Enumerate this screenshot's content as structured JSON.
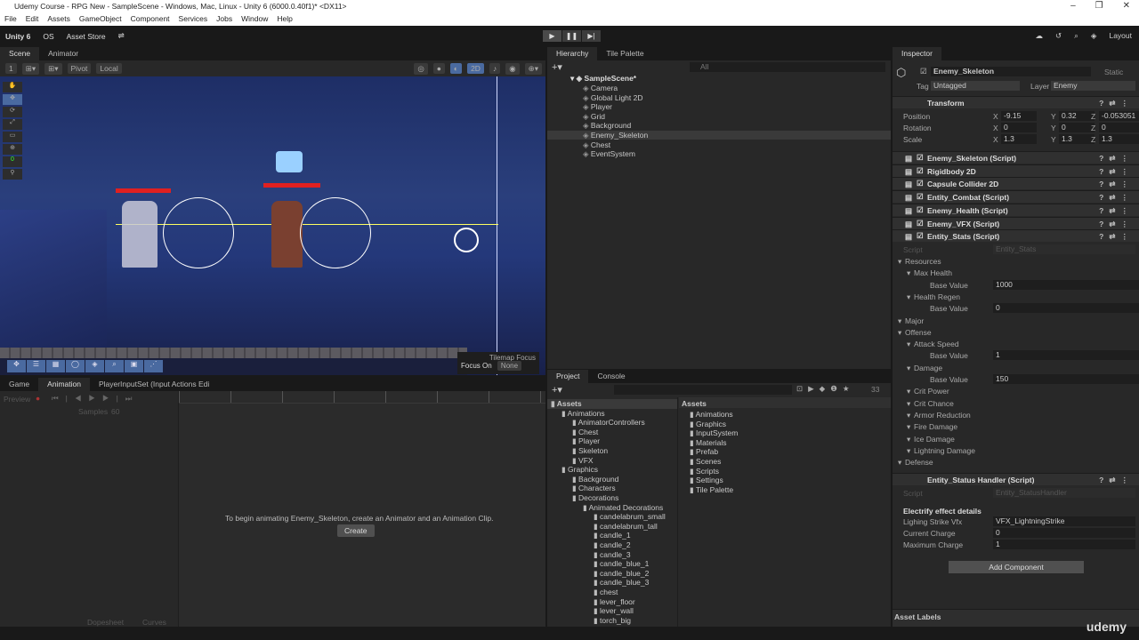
{
  "window": {
    "title": "Udemy Course - RPG New - SampleScene - Windows, Mac, Linux - Unity 6 (6000.0.40f1)* <DX11>"
  },
  "menu": [
    "File",
    "Edit",
    "Assets",
    "GameObject",
    "Component",
    "Services",
    "Jobs",
    "Window",
    "Help"
  ],
  "toolbar": {
    "account": "Unity 6",
    "os": "OS",
    "asset_store": "Asset Store",
    "layout": "Layout"
  },
  "scene_tabs": [
    "Scene",
    "Animator"
  ],
  "scene_toolbar": {
    "layer": "1",
    "pivot": "Pivot",
    "local": "Local",
    "mode_2d": "2D"
  },
  "scene": {
    "tilemap_focus": "Tilemap Focus",
    "focus_on": "Focus On",
    "focus_value": "None"
  },
  "bottom_tabs": [
    "Game",
    "Animation",
    "PlayerInputSet (Input Actions Edi"
  ],
  "animation": {
    "preview": "Preview",
    "samples_label": "Samples",
    "samples": "60",
    "message": "To begin animating Enemy_Skeleton, create an Animator and an Animation Clip.",
    "create": "Create",
    "dopesheet": "Dopesheet",
    "curves": "Curves"
  },
  "hierarchy": {
    "title": "Hierarchy",
    "tab2": "Tile Palette",
    "search_placeholder": "All",
    "scene": "SampleScene*",
    "items": [
      "Camera",
      "Global Light 2D",
      "Player",
      "Grid",
      "Background",
      "Enemy_Skeleton",
      "Chest",
      "EventSystem"
    ],
    "selected": "Enemy_Skeleton"
  },
  "project": {
    "tabs": [
      "Project",
      "Console"
    ],
    "count": "33",
    "tree": [
      {
        "label": "Assets",
        "depth": 0
      },
      {
        "label": "Animations",
        "depth": 1
      },
      {
        "label": "AnimatorControllers",
        "depth": 2
      },
      {
        "label": "Chest",
        "depth": 2
      },
      {
        "label": "Player",
        "depth": 2
      },
      {
        "label": "Skeleton",
        "depth": 2
      },
      {
        "label": "VFX",
        "depth": 2
      },
      {
        "label": "Graphics",
        "depth": 1
      },
      {
        "label": "Background",
        "depth": 2
      },
      {
        "label": "Characters",
        "depth": 2
      },
      {
        "label": "Decorations",
        "depth": 2
      },
      {
        "label": "Animated Decorations",
        "depth": 3
      },
      {
        "label": "candelabrum_small",
        "depth": 4
      },
      {
        "label": "candelabrum_tall",
        "depth": 4
      },
      {
        "label": "candle_1",
        "depth": 4
      },
      {
        "label": "candle_2",
        "depth": 4
      },
      {
        "label": "candle_3",
        "depth": 4
      },
      {
        "label": "candle_blue_1",
        "depth": 4
      },
      {
        "label": "candle_blue_2",
        "depth": 4
      },
      {
        "label": "candle_blue_3",
        "depth": 4
      },
      {
        "label": "chest",
        "depth": 4
      },
      {
        "label": "lever_floor",
        "depth": 4
      },
      {
        "label": "lever_wall",
        "depth": 4
      },
      {
        "label": "torch_big",
        "depth": 4
      }
    ],
    "breadcrumb": "Assets",
    "folders": [
      "Animations",
      "Graphics",
      "InputSystem",
      "Materials",
      "Prefab",
      "Scenes",
      "Scripts",
      "Settings",
      "Tile Palette"
    ]
  },
  "inspector": {
    "title": "Inspector",
    "object": "Enemy_Skeleton",
    "static": "Static",
    "tag_label": "Tag",
    "tag": "Untagged",
    "layer_label": "Layer",
    "layer": "Enemy",
    "transform": {
      "title": "Transform",
      "rows": [
        {
          "label": "Position",
          "x": "-9.15",
          "y": "0.32",
          "z": "-0.053051"
        },
        {
          "label": "Rotation",
          "x": "0",
          "y": "0",
          "z": "0"
        },
        {
          "label": "Scale",
          "x": "1.3",
          "y": "1.3",
          "z": "1.3"
        }
      ]
    },
    "components": [
      "Enemy_Skeleton (Script)",
      "Rigidbody 2D",
      "Capsule Collider 2D",
      "Entity_Combat (Script)",
      "Enemy_Health (Script)",
      "Enemy_VFX (Script)",
      "Entity_Stats (Script)"
    ],
    "stats": {
      "script_label": "Script",
      "script": "Entity_Stats",
      "rows": [
        {
          "label": "Resources",
          "depth": 0
        },
        {
          "label": "Max Health",
          "depth": 1
        },
        {
          "label": "Base Value",
          "depth": 2,
          "value": "1000"
        },
        {
          "label": "Health Regen",
          "depth": 1
        },
        {
          "label": "Base Value",
          "depth": 2,
          "value": "0"
        },
        {
          "label": "Major",
          "depth": 0
        },
        {
          "label": "Offense",
          "depth": 0
        },
        {
          "label": "Attack Speed",
          "depth": 1
        },
        {
          "label": "Base Value",
          "depth": 2,
          "value": "1"
        },
        {
          "label": "Damage",
          "depth": 1
        },
        {
          "label": "Base Value",
          "depth": 2,
          "value": "150"
        },
        {
          "label": "Crit Power",
          "depth": 1
        },
        {
          "label": "Crit Chance",
          "depth": 1
        },
        {
          "label": "Armor Reduction",
          "depth": 1
        },
        {
          "label": "Fire Damage",
          "depth": 1
        },
        {
          "label": "Ice Damage",
          "depth": 1
        },
        {
          "label": "Lightning Damage",
          "depth": 1
        },
        {
          "label": "Defense",
          "depth": 0
        }
      ]
    },
    "status_handler": {
      "title": "Entity_Status Handler (Script)",
      "script_label": "Script",
      "script": "Entity_StatusHandler",
      "section": "Electrify effect details",
      "vfx_label": "Lighing Strike Vfx",
      "vfx": "VFX_LightningStrike",
      "current_label": "Current Charge",
      "current": "0",
      "max_label": "Maximum Charge",
      "max": "1"
    },
    "add_component": "Add Component",
    "asset_labels": "Asset Labels"
  },
  "watermark": "udemy"
}
